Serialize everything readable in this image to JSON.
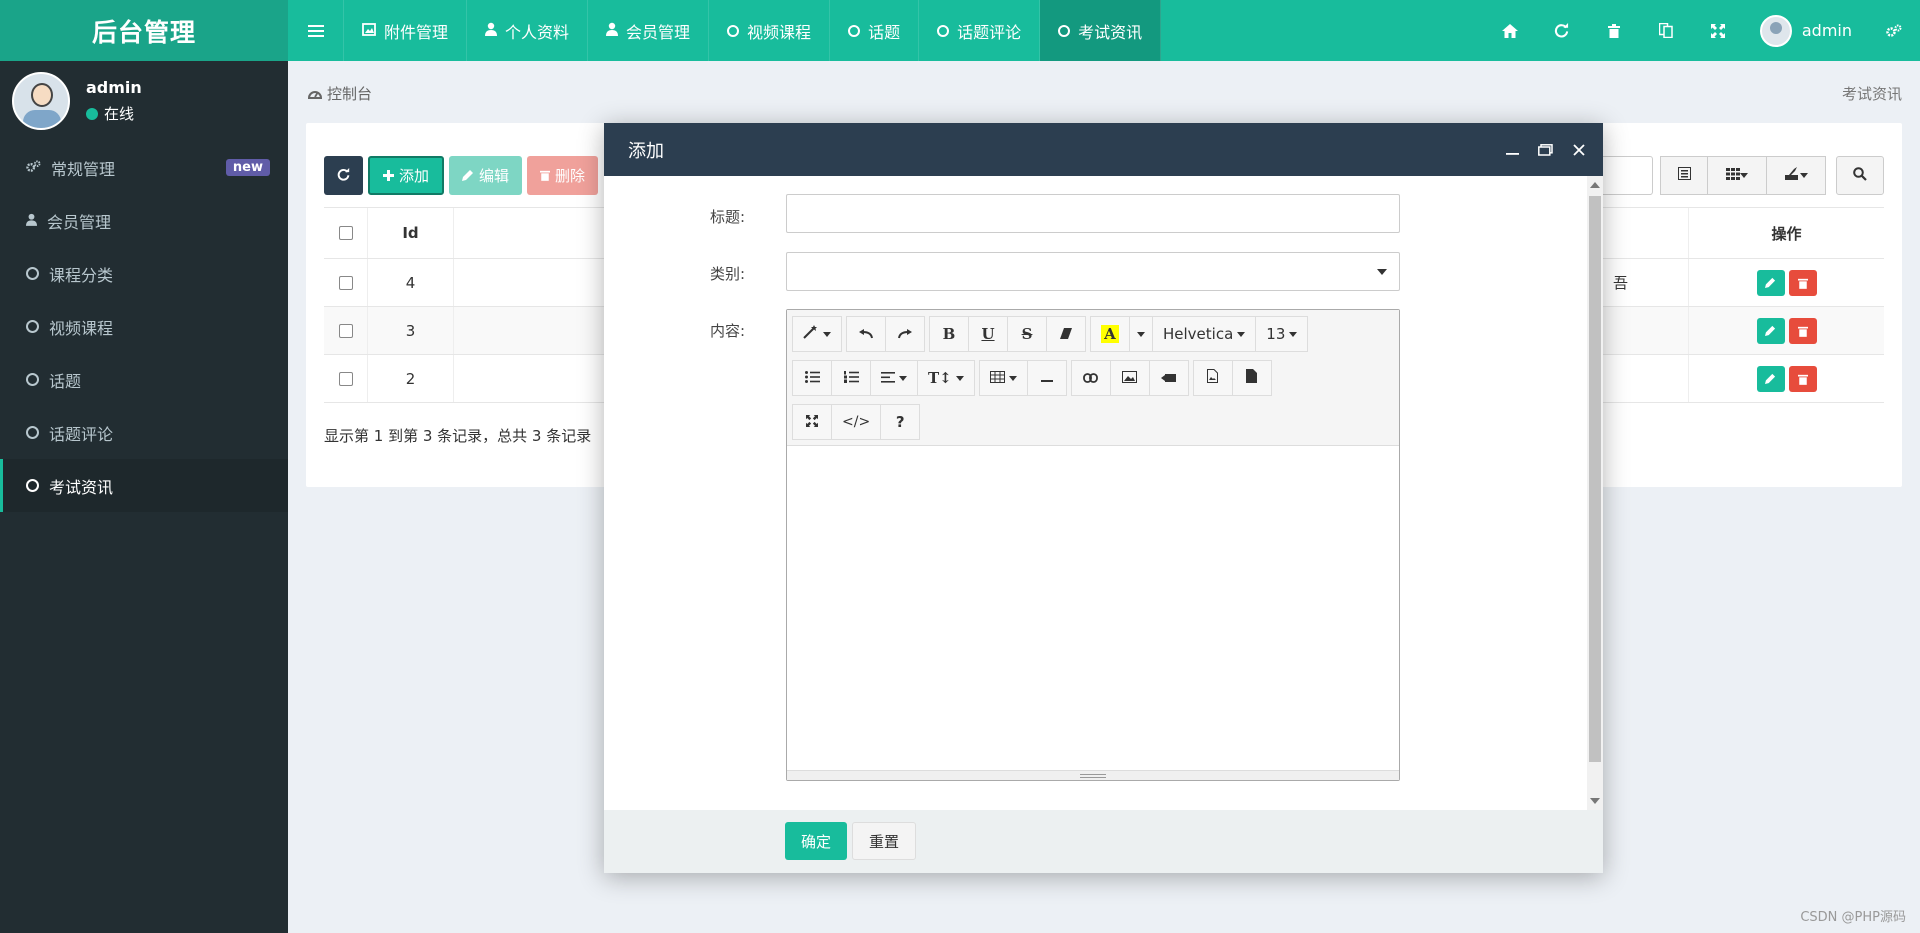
{
  "brand": {
    "title": "后台管理"
  },
  "nav": {
    "tabs": [
      {
        "label": "附件管理",
        "icon": "image-icon"
      },
      {
        "label": "个人资料",
        "icon": "user-icon"
      },
      {
        "label": "会员管理",
        "icon": "user-icon"
      },
      {
        "label": "视频课程",
        "icon": "circle-icon"
      },
      {
        "label": "话题",
        "icon": "circle-icon"
      },
      {
        "label": "话题评论",
        "icon": "circle-icon"
      },
      {
        "label": "考试资讯",
        "icon": "circle-icon",
        "active": true
      }
    ],
    "user": "admin"
  },
  "sidebar": {
    "profile": {
      "name": "admin",
      "status": "在线"
    },
    "items": [
      {
        "label": "常规管理",
        "badge": "new"
      },
      {
        "label": "会员管理"
      },
      {
        "label": "课程分类"
      },
      {
        "label": "视频课程"
      },
      {
        "label": "话题"
      },
      {
        "label": "话题评论"
      },
      {
        "label": "考试资讯",
        "active": true
      }
    ]
  },
  "breadcrumb": {
    "left": "控制台",
    "right": "考试资讯"
  },
  "toolbar": {
    "add": "添加",
    "edit": "编辑",
    "delete": "删除"
  },
  "table": {
    "headers": {
      "id": "Id",
      "actions": "操作"
    },
    "rows": [
      {
        "id": "4",
        "text": "吾"
      },
      {
        "id": "3",
        "text": ""
      },
      {
        "id": "2",
        "text": ""
      }
    ],
    "summary": "显示第 1 到第 3 条记录，总共 3 条记录"
  },
  "modal": {
    "title": "添加",
    "fields": {
      "title_label": "标题:",
      "category_label": "类别:",
      "content_label": "内容:"
    },
    "editor": {
      "font": "Helvetica",
      "size": "13"
    },
    "buttons": {
      "ok": "确定",
      "reset": "重置"
    }
  },
  "watermark": "CSDN @PHP源码",
  "colors": {
    "primary": "#18bc9c",
    "dark": "#2c3e50",
    "sidebar": "#222d32",
    "danger": "#e74c3c",
    "badge": "#605ca8"
  }
}
